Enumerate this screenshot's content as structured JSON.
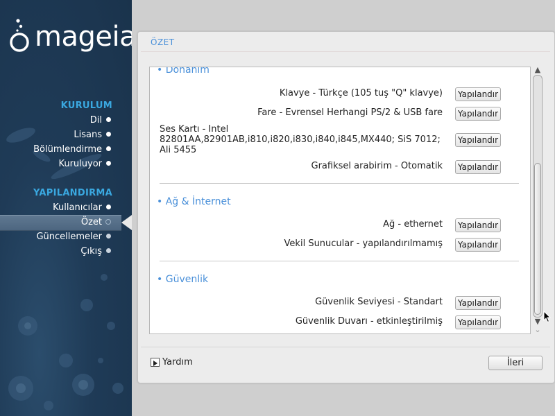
{
  "sidebar": {
    "logo_text": "mageia",
    "sections": [
      {
        "title": "KURULUM",
        "items": [
          "Dil",
          "Lisans",
          "Bölümlendirme",
          "Kuruluyor"
        ]
      },
      {
        "title": "YAPILANDIRMA",
        "items": [
          "Kullanıcılar",
          "Özet",
          "Güncellemeler",
          "Çıkış"
        ]
      }
    ],
    "active_item": "Özet"
  },
  "main": {
    "title": "ÖZET",
    "categories": [
      {
        "name": "Donanım",
        "rows": [
          {
            "label": "Klavye - Türkçe (105 tuş \"Q\" klavye)",
            "button": "Yapılandır"
          },
          {
            "label": "Fare - Evrensel Herhangi PS/2 & USB fare",
            "button": "Yapılandır"
          },
          {
            "label": "Ses Kartı - Intel 82801AA,82901AB,i810,i820,i830,i840,i845,MX440; SiS 7012; Ali 5455",
            "button": "Yapılandır"
          },
          {
            "label": "Grafiksel arabirim - Otomatik",
            "button": "Yapılandır"
          }
        ]
      },
      {
        "name": "Ağ & İnternet",
        "rows": [
          {
            "label": "Ağ - ethernet",
            "button": "Yapılandır"
          },
          {
            "label": "Vekil Sunucular - yapılandırılmamış",
            "button": "Yapılandır"
          }
        ]
      },
      {
        "name": "Güvenlik",
        "rows": [
          {
            "label": "Güvenlik Seviyesi - Standart",
            "button": "Yapılandır"
          },
          {
            "label": "Güvenlik Duvarı - etkinleştirilmiş",
            "button": "Yapılandır"
          }
        ]
      }
    ],
    "scroll_position": 0.62
  },
  "footer": {
    "help_label": "Yardım",
    "next_label": "İleri"
  },
  "colors": {
    "sidebar_bg": "#1f3b57",
    "section_title": "#3aa8e0",
    "category_title": "#4a90d9"
  },
  "icons": {
    "scroll_up": "▲",
    "scroll_down": "▼",
    "scroll_down_small": "⌄"
  }
}
